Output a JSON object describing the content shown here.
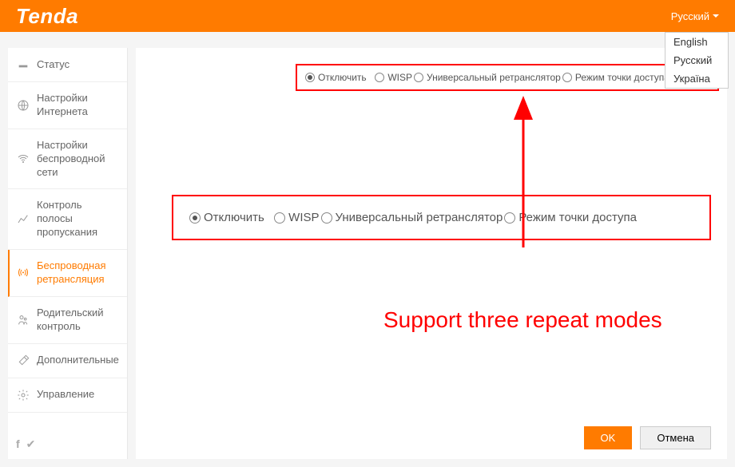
{
  "header": {
    "logo_text": "Tenda",
    "lang_current": "Русский",
    "lang_options": [
      "English",
      "Русский",
      "Україна"
    ]
  },
  "sidebar": {
    "items": [
      {
        "label": "Статус"
      },
      {
        "label": "Настройки Интернета"
      },
      {
        "label": "Настройки беспроводной сети"
      },
      {
        "label": "Контроль полосы пропускания"
      },
      {
        "label": "Беспроводная ретрансляция"
      },
      {
        "label": "Родительский контроль"
      },
      {
        "label": "Дополнительные"
      },
      {
        "label": "Управление"
      }
    ]
  },
  "radios": {
    "opt1": "Отключить",
    "opt2": "WISP",
    "opt3": "Универсальный ретранслятор",
    "opt4": "Режим точки доступа"
  },
  "annotation": "Support three repeat modes",
  "buttons": {
    "ok": "OK",
    "cancel": "Отмена"
  }
}
